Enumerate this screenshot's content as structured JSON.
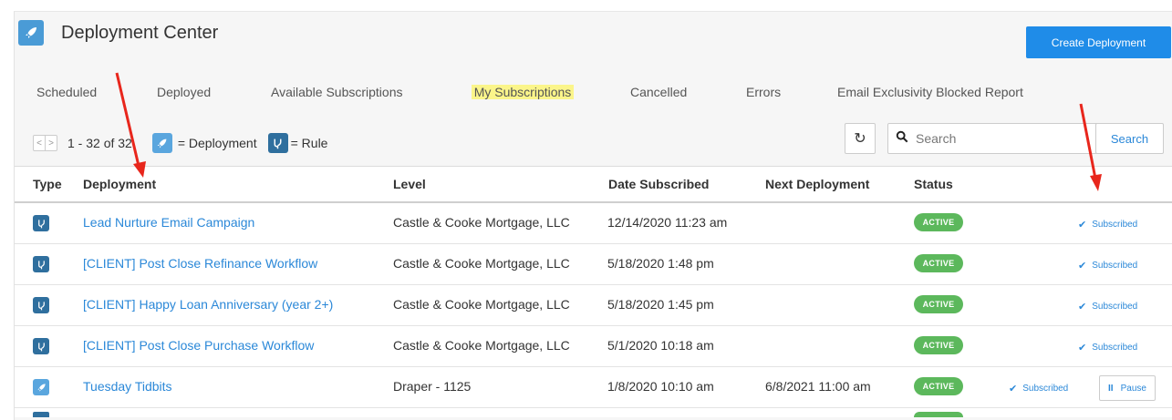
{
  "app": {
    "title": "Deployment Center",
    "create_button": "Create Deployment"
  },
  "tabs": [
    {
      "label": "Scheduled"
    },
    {
      "label": "Deployed"
    },
    {
      "label": "Available Subscriptions"
    },
    {
      "label": "My Subscriptions",
      "active": true
    },
    {
      "label": "Cancelled"
    },
    {
      "label": "Errors"
    },
    {
      "label": "Email Exclusivity Blocked Report"
    }
  ],
  "toolbar": {
    "pager_prev": "<",
    "pager_next": ">",
    "count": "1 - 32 of 32",
    "legend_deployment": "= Deployment",
    "legend_rule": "= Rule",
    "search_placeholder": "Search",
    "search_button": "Search",
    "refresh_icon": "refresh-icon"
  },
  "table": {
    "columns": [
      "Type",
      "Deployment",
      "Level",
      "Date Subscribed",
      "Next Deployment",
      "Status"
    ],
    "rows": [
      {
        "type": "rule",
        "name": "Lead Nurture Email Campaign",
        "level": "Castle & Cooke Mortgage, LLC",
        "date": "12/14/2020 11:23 am",
        "next": "",
        "status": "ACTIVE",
        "subscribed": "Subscribed"
      },
      {
        "type": "rule",
        "name": "[CLIENT] Post Close Refinance Workflow",
        "level": "Castle & Cooke Mortgage, LLC",
        "date": "5/18/2020 1:48 pm",
        "next": "",
        "status": "ACTIVE",
        "subscribed": "Subscribed"
      },
      {
        "type": "rule",
        "name": "[CLIENT] Happy Loan Anniversary (year 2+)",
        "level": "Castle & Cooke Mortgage, LLC",
        "date": "5/18/2020 1:45 pm",
        "next": "",
        "status": "ACTIVE",
        "subscribed": "Subscribed"
      },
      {
        "type": "rule",
        "name": "[CLIENT] Post Close Purchase Workflow",
        "level": "Castle & Cooke Mortgage, LLC",
        "date": "5/1/2020 10:18 am",
        "next": "",
        "status": "ACTIVE",
        "subscribed": "Subscribed"
      },
      {
        "type": "deployment",
        "name": "Tuesday Tidbits",
        "level": "Draper - 1125",
        "date": "1/8/2020 10:10 am",
        "next": "6/8/2021 11:00 am",
        "status": "ACTIVE",
        "subscribed": "Subscribed",
        "pause": "Pause"
      }
    ]
  },
  "colors": {
    "accent": "#1f8ce8",
    "link": "#2b88d8",
    "active_badge": "#5cb85c",
    "highlight": "#fbf58a",
    "annotation_arrow": "#e8261c"
  }
}
